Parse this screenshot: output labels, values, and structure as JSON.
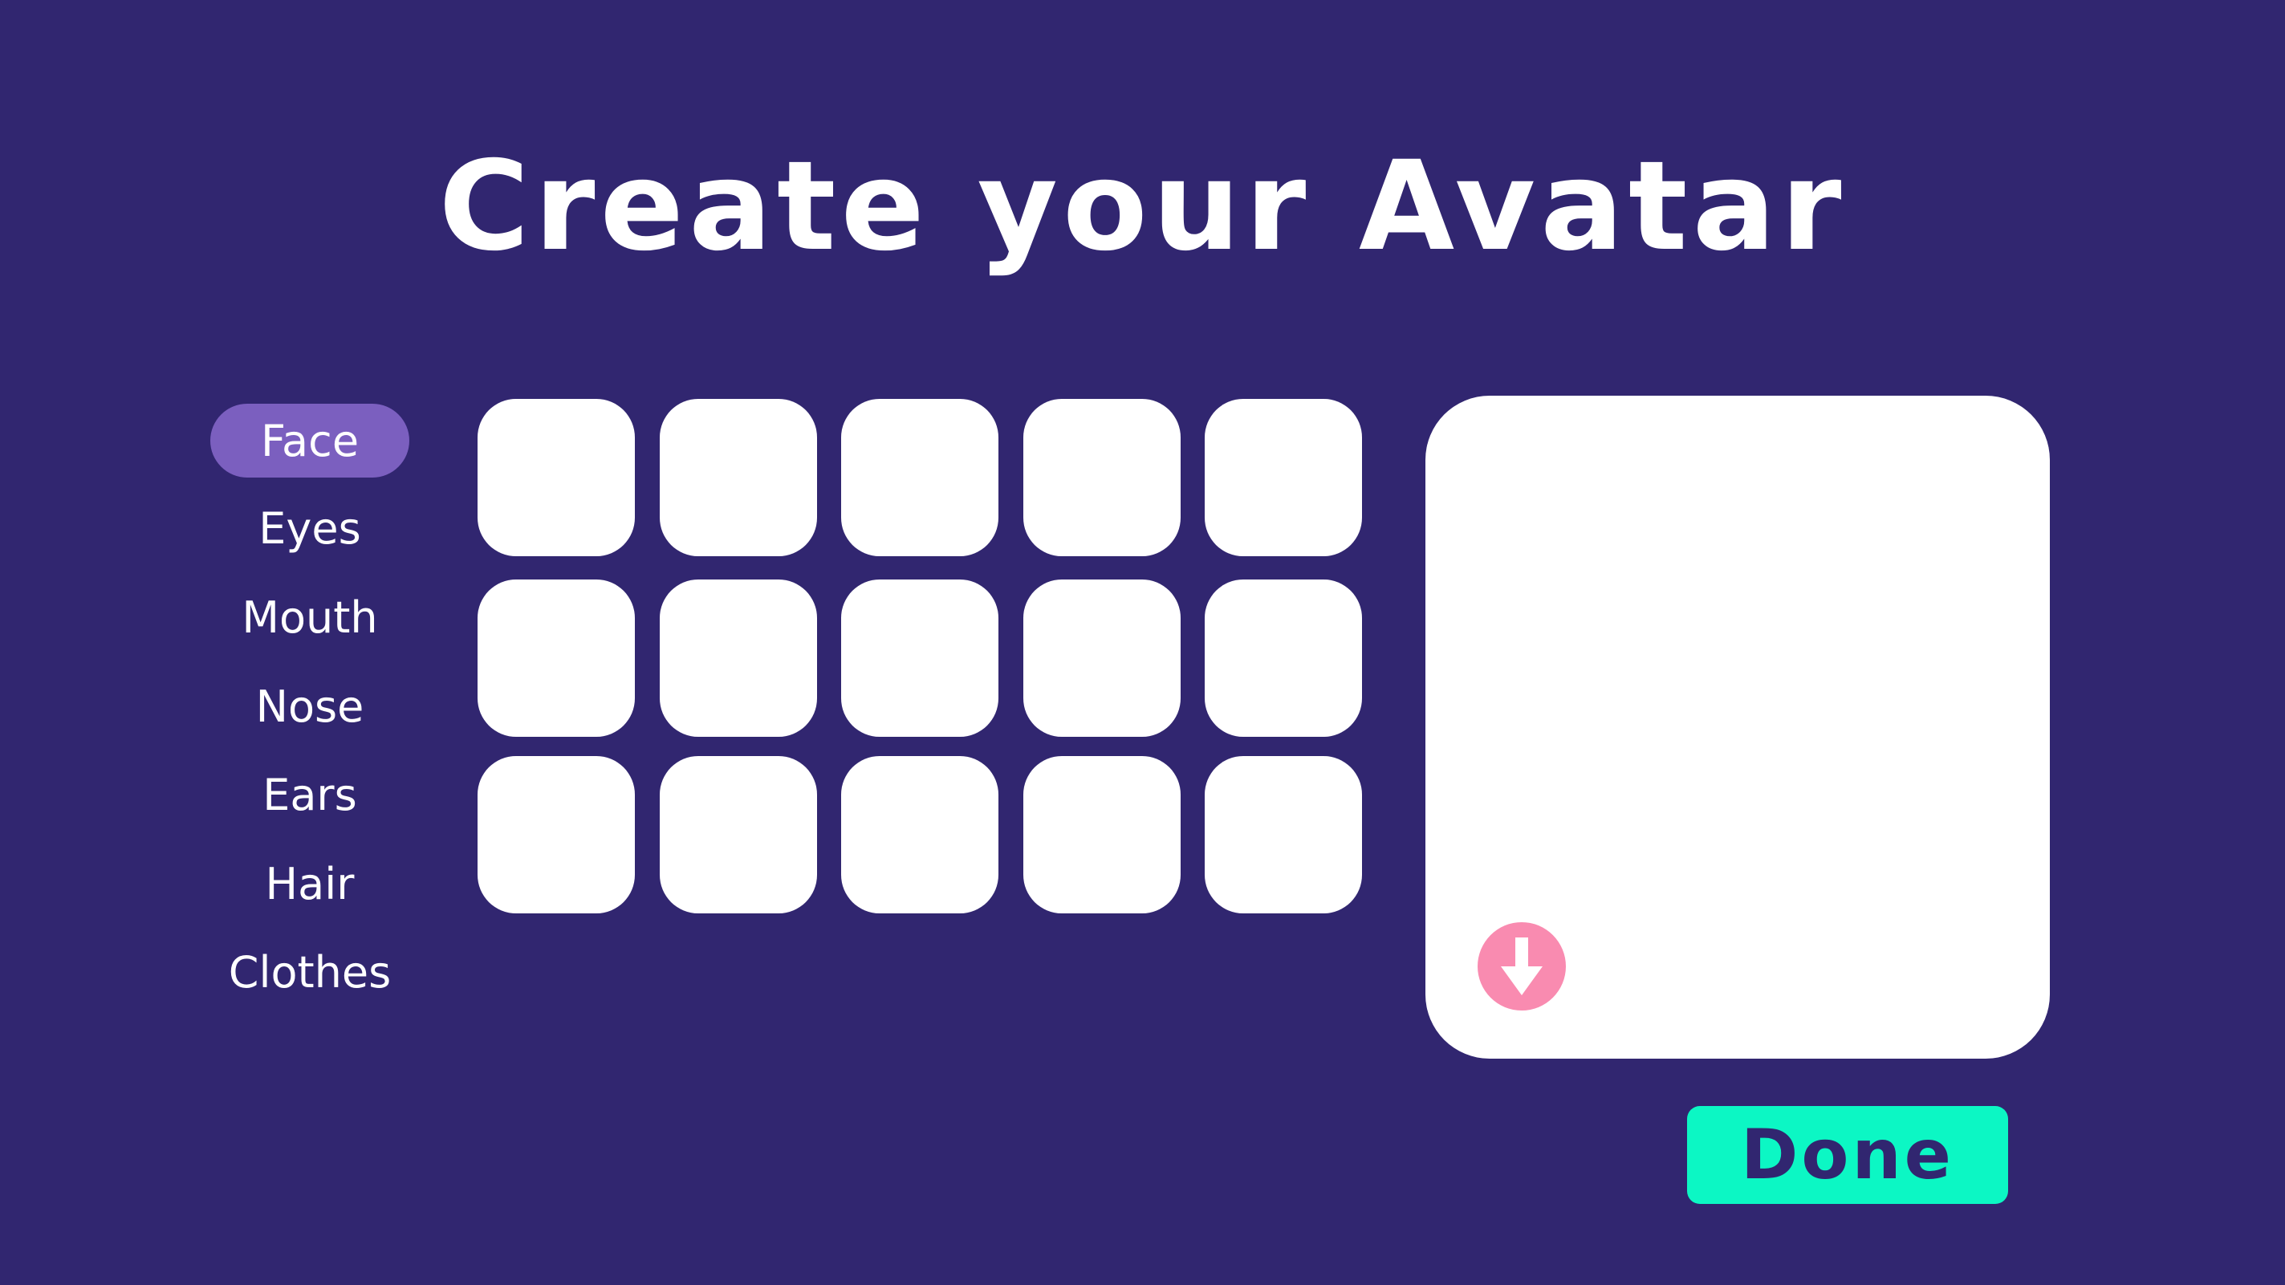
{
  "title": "Create your Avatar",
  "menu": {
    "items": [
      {
        "label": "Face",
        "active": true
      },
      {
        "label": "Eyes",
        "active": false
      },
      {
        "label": "Mouth",
        "active": false
      },
      {
        "label": "Nose",
        "active": false
      },
      {
        "label": "Ears",
        "active": false
      },
      {
        "label": "Hair",
        "active": false
      },
      {
        "label": "Clothes",
        "active": false
      }
    ]
  },
  "options_grid": {
    "rows": 3,
    "columns": 5
  },
  "preview": {
    "download_icon": "arrow-down-icon"
  },
  "done_label": "Done",
  "colors": {
    "background": "#312670",
    "active_menu": "#7b5fbf",
    "download_button": "#f98bb0",
    "done_button": "#0cf7c4",
    "done_text": "#312670",
    "tile": "#ffffff"
  }
}
